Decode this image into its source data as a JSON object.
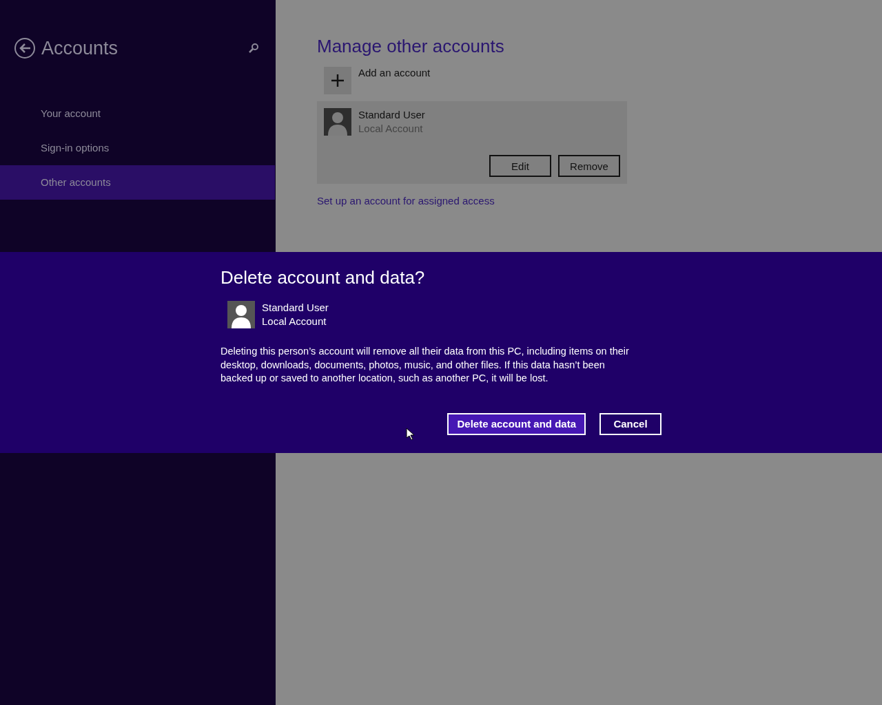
{
  "sidebar": {
    "title": "Accounts",
    "items": [
      {
        "label": "Your account",
        "selected": false
      },
      {
        "label": "Sign-in options",
        "selected": false
      },
      {
        "label": "Other accounts",
        "selected": true
      }
    ]
  },
  "content": {
    "title": "Manage other accounts",
    "add_account": "Add an account",
    "account": {
      "name": "Standard User",
      "type": "Local Account",
      "buttons": [
        "Edit",
        "Remove"
      ]
    },
    "link": "Set up an account for assigned access"
  },
  "dialog": {
    "title": "Delete account and data?",
    "account": {
      "name": "Standard User",
      "type": "Local Account"
    },
    "message": "Deleting this person’s account will remove all their data from this PC, including items on their desktop, downloads, documents, photos, music, and other files. If this data hasn’t been backed up or saved to another location, such as another PC, it will be lost.",
    "buttons": [
      {
        "label": "Delete account and data",
        "kind": "primary"
      },
      {
        "label": "Cancel",
        "kind": "secondary"
      }
    ]
  }
}
